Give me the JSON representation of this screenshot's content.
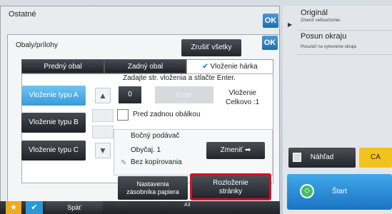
{
  "outer": {
    "title": "Ostatné",
    "ok_label": "OK"
  },
  "dialog": {
    "title": "Obaly/prílohy",
    "cancel_all_label": "Zrušiť všetky",
    "ok_label": "OK"
  },
  "tabs": [
    "Predný obal",
    "Zadný obal",
    "Vloženie hárka"
  ],
  "instruction": "Zadajte str. vloženia a stlačte Enter.",
  "types": [
    "Vloženie typu A",
    "Vloženie typu B",
    "Vloženie typu C"
  ],
  "page_value": "0",
  "enter_label": "Enter",
  "insertion_total": {
    "line1": "Vloženie",
    "line2": "Celkovo :1"
  },
  "before_back_cover_label": "Pred zadnou obálkou",
  "feed": {
    "source": "Bočný podávač",
    "paper": "Obyčaj. 1",
    "no_copy": "Bez kopírovania",
    "change_label": "Zmeniť"
  },
  "tray_settings_label": {
    "line1": "Nastavenia",
    "line2": "zásobníka papiera"
  },
  "page_layout_label": {
    "line1": "Rozloženie",
    "line2": "stránky"
  },
  "bottom": {
    "back_label": "Späť",
    "paper_size": "A3"
  },
  "right_panel": {
    "original_label": "Originál",
    "original_sub": "Zmeniť veľkosť/smer.",
    "margin_shift_label": "Posun okraju",
    "margin_shift_sub": "Posunúť na vytvorenie okraja",
    "preview_label": "Náhľad",
    "ca_label": "CA",
    "start_label": "Štart"
  },
  "colors": {
    "accent_blue": "#3a9ad8",
    "highlight_red": "#d3122a",
    "ca_yellow": "#f3c31d"
  }
}
